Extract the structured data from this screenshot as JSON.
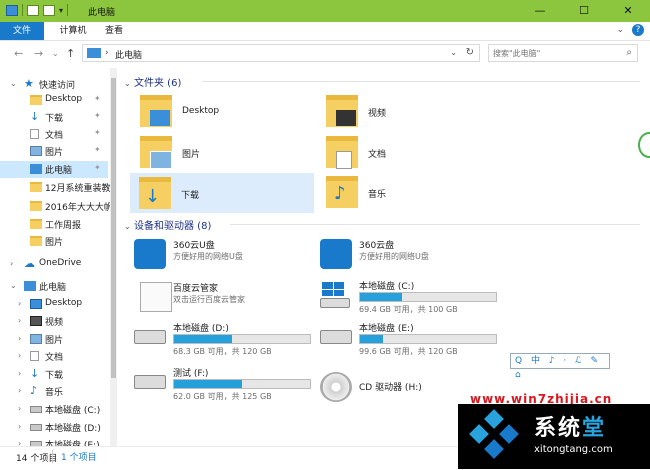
{
  "window": {
    "title": "此电脑",
    "controls": [
      "—",
      "☐",
      "✕"
    ]
  },
  "ribbon": {
    "tabs": [
      "文件",
      "计算机",
      "查看"
    ],
    "chevron": "⌄",
    "help": "?"
  },
  "address": {
    "path": "此电脑",
    "search_placeholder": "搜索\"此电脑\""
  },
  "sidebar": {
    "items": [
      {
        "label": "快速访问",
        "icon": "star-icon",
        "level": 0
      },
      {
        "label": "Desktop",
        "icon": "folder-icon",
        "level": 1,
        "pinned": true
      },
      {
        "label": "下载",
        "icon": "download-icon",
        "level": 1,
        "pinned": true
      },
      {
        "label": "文档",
        "icon": "document-icon",
        "level": 1,
        "pinned": true
      },
      {
        "label": "图片",
        "icon": "picture-icon",
        "level": 1,
        "pinned": true
      },
      {
        "label": "此电脑",
        "icon": "computer-icon",
        "level": 1,
        "pinned": true,
        "selected": true
      },
      {
        "label": "12月系统重装教",
        "icon": "folder-icon",
        "level": 1
      },
      {
        "label": "2016年大大大帆",
        "icon": "folder-icon",
        "level": 1
      },
      {
        "label": "工作周报",
        "icon": "folder-icon",
        "level": 1
      },
      {
        "label": "图片",
        "icon": "folder-icon",
        "level": 1
      },
      {
        "label": "OneDrive",
        "icon": "cloud-icon",
        "level": 0
      },
      {
        "label": "此电脑",
        "icon": "computer-icon",
        "level": 0
      },
      {
        "label": "Desktop",
        "icon": "desktop-icon",
        "level": 1
      },
      {
        "label": "视频",
        "icon": "video-icon",
        "level": 1
      },
      {
        "label": "图片",
        "icon": "picture-icon",
        "level": 1
      },
      {
        "label": "文档",
        "icon": "document-icon",
        "level": 1
      },
      {
        "label": "下载",
        "icon": "download-icon",
        "level": 1
      },
      {
        "label": "音乐",
        "icon": "music-icon",
        "level": 1
      },
      {
        "label": "本地磁盘 (C:)",
        "icon": "drive-icon",
        "level": 1
      },
      {
        "label": "本地磁盘 (D:)",
        "icon": "drive-icon",
        "level": 1
      },
      {
        "label": "本地磁盘 (E:)",
        "icon": "drive-icon",
        "level": 1
      }
    ]
  },
  "folders": {
    "heading": "文件夹 (6)",
    "items": [
      {
        "name": "Desktop",
        "icon": "desktop-folder-icon"
      },
      {
        "name": "视频",
        "icon": "video-folder-icon"
      },
      {
        "name": "图片",
        "icon": "picture-folder-icon"
      },
      {
        "name": "文档",
        "icon": "document-folder-icon"
      },
      {
        "name": "下载",
        "icon": "download-folder-icon",
        "selected": true
      },
      {
        "name": "音乐",
        "icon": "music-folder-icon"
      }
    ]
  },
  "devices": {
    "heading": "设备和驱动器 (8)",
    "items": [
      {
        "name": "360云U盘",
        "desc": "方便好用的网络U盘",
        "icon": "usb-cloud-icon"
      },
      {
        "name": "360云盘",
        "desc": "方便好用的网络U盘",
        "icon": "cloud-drive-icon"
      },
      {
        "name": "百度云管家",
        "desc": "双击运行百度云管家",
        "icon": "blank-document-icon"
      },
      {
        "name": "本地磁盘 (C:)",
        "free": "69.4 GB 可用，共 100 GB",
        "used_fraction": 0.31,
        "icon": "windows-drive-icon"
      },
      {
        "name": "本地磁盘 (D:)",
        "free": "68.3 GB 可用，共 120 GB",
        "used_fraction": 0.43,
        "icon": "hard-drive-icon"
      },
      {
        "name": "本地磁盘 (E:)",
        "free": "99.6 GB 可用，共 120 GB",
        "used_fraction": 0.17,
        "icon": "hard-drive-icon"
      },
      {
        "name": "测试 (F:)",
        "free": "62.0 GB 可用，共 125 GB",
        "used_fraction": 0.5,
        "icon": "hard-drive-icon"
      },
      {
        "name": "CD 驱动器 (H:)",
        "icon": "cd-drive-icon"
      }
    ]
  },
  "status": {
    "item_count": "14 个项目",
    "selected": "1 个项目"
  },
  "ime_bar": "Q 中 ♪ ⋅ ℒ ✎ ⌂",
  "watermark": {
    "url": "www.win7zhijia.cn",
    "name_a": "系统",
    "name_b": "堂",
    "site": "xitongtang.com"
  }
}
